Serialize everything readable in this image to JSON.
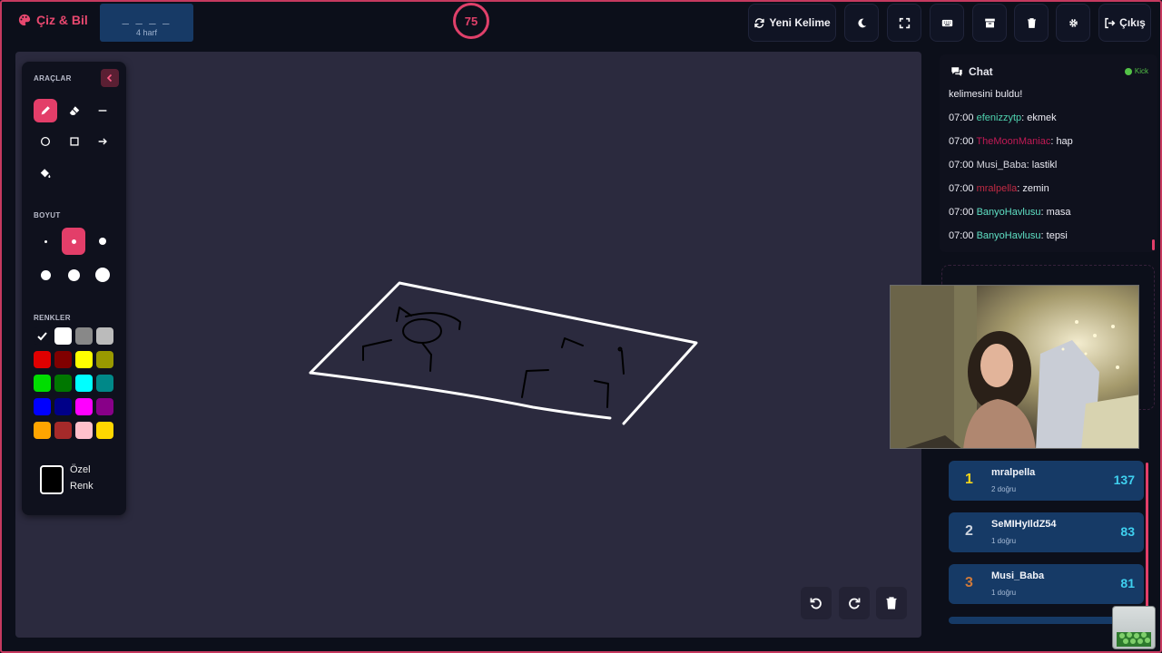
{
  "app": {
    "title": "Çiz & Bil"
  },
  "word": {
    "pattern": "_ _ _ _",
    "hint": "4 harf"
  },
  "timer": {
    "value": "75"
  },
  "toolbar": {
    "new_word_label": "Yeni Kelime",
    "exit_label": "Çıkış"
  },
  "tools": {
    "section_tools": "ARAÇLAR",
    "section_size": "BOYUT",
    "section_colors": "RENKLER",
    "custom_color_label": "Özel Renk",
    "active_tool": "pencil",
    "active_size_index": 1,
    "colors": [
      "#000000",
      "#ffffff",
      "#888888",
      "#bbbbbb",
      "#e00000",
      "#800000",
      "#ffff00",
      "#999900",
      "#00dd00",
      "#007700",
      "#00ffff",
      "#008888",
      "#0000ff",
      "#000088",
      "#ff00ff",
      "#880088",
      "#ffa500",
      "#a52a2a",
      "#ffc0cb",
      "#ffd700"
    ]
  },
  "chat": {
    "title": "Chat",
    "platform": "Kick",
    "partial_line": "kelimesini buldu!",
    "messages": [
      {
        "time": "07:00",
        "user": "efenizzytp",
        "user_color": "#4fd4b0",
        "text": ": ekmek"
      },
      {
        "time": "07:00",
        "user": "TheMoonManiac",
        "user_color": "#c21a55",
        "text": ": hap"
      },
      {
        "time": "07:00",
        "user": "Musi_Baba",
        "user_color": "#d8d8e0",
        "text": ": lastikl"
      },
      {
        "time": "07:00",
        "user": "mralpella",
        "user_color": "#c22a44",
        "text": ": zemin"
      },
      {
        "time": "07:00",
        "user": "BanyoHavlusu",
        "user_color": "#5fe0c4",
        "text": ": masa"
      },
      {
        "time": "07:00",
        "user": "BanyoHavlusu",
        "user_color": "#5fe0c4",
        "text": ": tepsi"
      }
    ]
  },
  "leaderboard": [
    {
      "rank": "1",
      "name": "mralpella",
      "sub": "2 doğru",
      "score": "137",
      "rank_color": "#f5d51a"
    },
    {
      "rank": "2",
      "name": "SeMIHyIldZ54",
      "sub": "1 doğru",
      "score": "83",
      "rank_color": "#cfd5df"
    },
    {
      "rank": "3",
      "name": "Musi_Baba",
      "sub": "1 doğru",
      "score": "81",
      "rank_color": "#d07a3a"
    }
  ]
}
